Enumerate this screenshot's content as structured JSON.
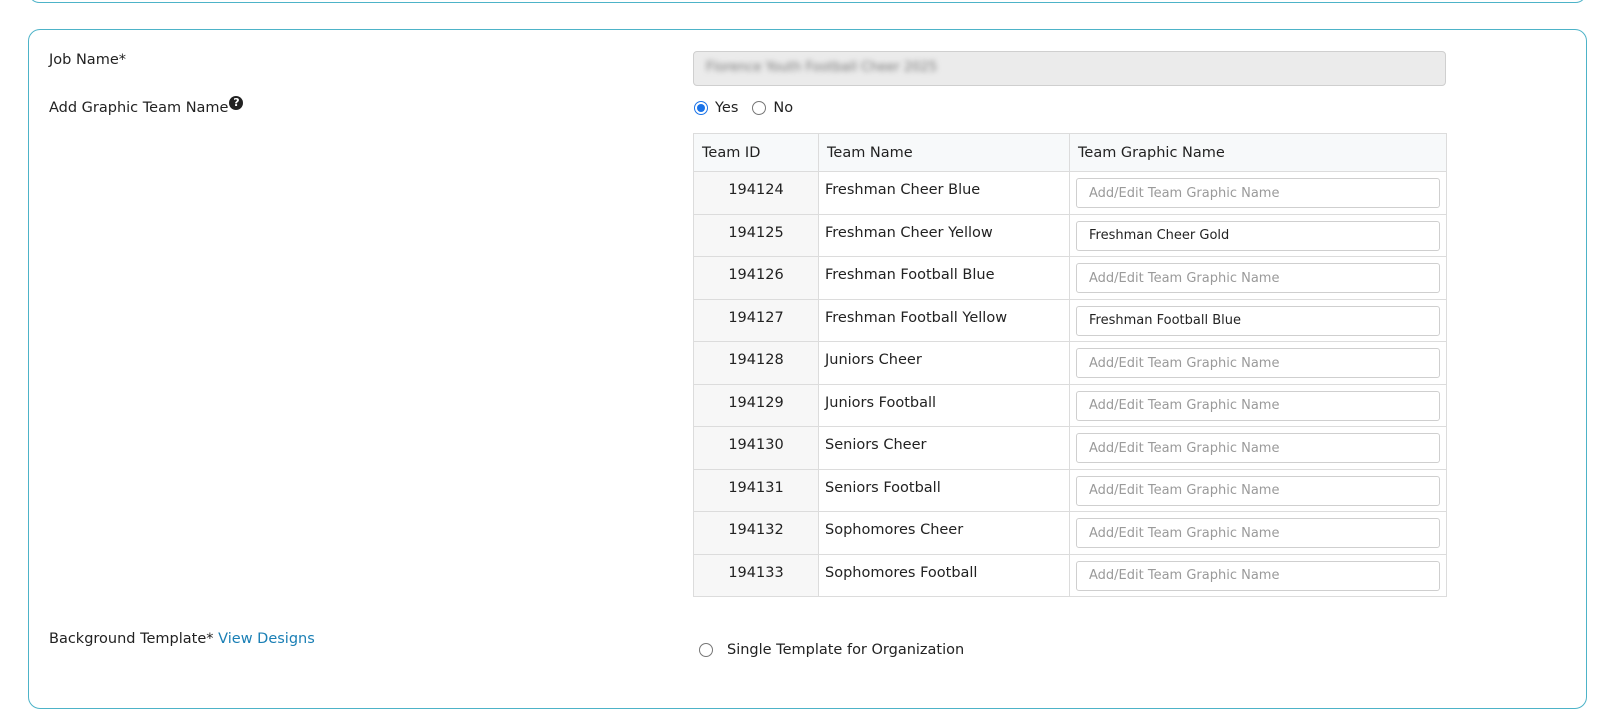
{
  "form": {
    "job_name_label": "Job Name*",
    "job_name_value": "Florence Youth Football Cheer 2025",
    "graphic_team_label": "Add Graphic Team Name",
    "help_icon": "question-circle-icon",
    "yes_label": "Yes",
    "no_label": "No",
    "selected_option": "Yes",
    "background_label": "Background Template*",
    "view_designs_label": "View Designs",
    "single_template_label": "Single Template for Organization"
  },
  "table": {
    "headers": [
      "Team ID",
      "Team Name",
      "Team Graphic Name"
    ],
    "placeholder": "Add/Edit Team Graphic Name",
    "rows": [
      {
        "id": "194124",
        "name": "Freshman Cheer Blue",
        "graphic": ""
      },
      {
        "id": "194125",
        "name": "Freshman Cheer Yellow",
        "graphic": "Freshman Cheer Gold"
      },
      {
        "id": "194126",
        "name": "Freshman Football Blue",
        "graphic": ""
      },
      {
        "id": "194127",
        "name": "Freshman Football Yellow",
        "graphic": "Freshman Football Blue"
      },
      {
        "id": "194128",
        "name": "Juniors Cheer",
        "graphic": ""
      },
      {
        "id": "194129",
        "name": "Juniors Football",
        "graphic": ""
      },
      {
        "id": "194130",
        "name": "Seniors Cheer",
        "graphic": ""
      },
      {
        "id": "194131",
        "name": "Seniors Football",
        "graphic": ""
      },
      {
        "id": "194132",
        "name": "Sophomores Cheer",
        "graphic": ""
      },
      {
        "id": "194133",
        "name": "Sophomores Football",
        "graphic": ""
      }
    ]
  },
  "colors": {
    "panel_border": "#4db3c8",
    "link": "#1a7fb5",
    "radio_accent": "#1a73e8"
  }
}
